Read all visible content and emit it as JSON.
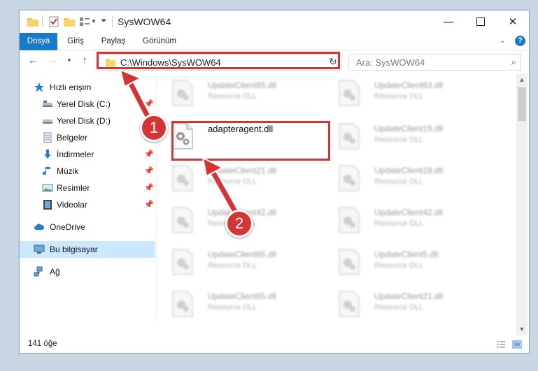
{
  "window": {
    "title": "SysWOW64"
  },
  "ribbon": {
    "tabs": [
      "Dosya",
      "Giriş",
      "Paylaş",
      "Görünüm"
    ]
  },
  "address": {
    "path": "C:\\Windows\\SysWOW64"
  },
  "search": {
    "placeholder": "Ara: SysWOW64"
  },
  "sidebar": {
    "quick_access": "Hızlı erişim",
    "items": [
      {
        "label": "Yerel Disk (C:)",
        "pinned": true
      },
      {
        "label": "Yerel Disk (D:)",
        "pinned": true
      },
      {
        "label": "Belgeler",
        "pinned": true
      },
      {
        "label": "İndirmeler",
        "pinned": true
      },
      {
        "label": "Müzik",
        "pinned": true
      },
      {
        "label": "Resimler",
        "pinned": true
      },
      {
        "label": "Videolar",
        "pinned": true
      }
    ],
    "onedrive": "OneDrive",
    "this_pc": "Bu bilgisayar",
    "network": "Ağ"
  },
  "files": {
    "col1": [
      {
        "name": "UpdateClient65.dll",
        "desc": "Resource DLL"
      },
      {
        "name": "adapteragent.dll",
        "desc": ""
      },
      {
        "name": "UpdateClient21.dll",
        "desc": "Resource DLL"
      },
      {
        "name": "UpdateClient42.dll",
        "desc": "Resource DLL"
      },
      {
        "name": "UpdateClient65.dll",
        "desc": "Resource DLL"
      },
      {
        "name": "UpdateClient65.dll",
        "desc": "Resource DLL"
      }
    ],
    "col2": [
      {
        "name": "UpdateClient63.dll",
        "desc": "Resource DLL"
      },
      {
        "name": "UpdateClient19.dll",
        "desc": "Resource DLL"
      },
      {
        "name": "UpdateClient19.dll",
        "desc": "Resource DLL"
      },
      {
        "name": "UpdateClient42.dll",
        "desc": "Resource DLL"
      },
      {
        "name": "UpdateClient5.dll",
        "desc": "Resource DLL"
      },
      {
        "name": "UpdateClient21.dll",
        "desc": "Resource DLL"
      }
    ]
  },
  "status": {
    "item_count": "141 öğe"
  },
  "annotations": {
    "step1": "1",
    "step2": "2"
  },
  "colors": {
    "accent": "#1979ca",
    "highlight": "#d43434",
    "selection": "#cce8ff"
  }
}
